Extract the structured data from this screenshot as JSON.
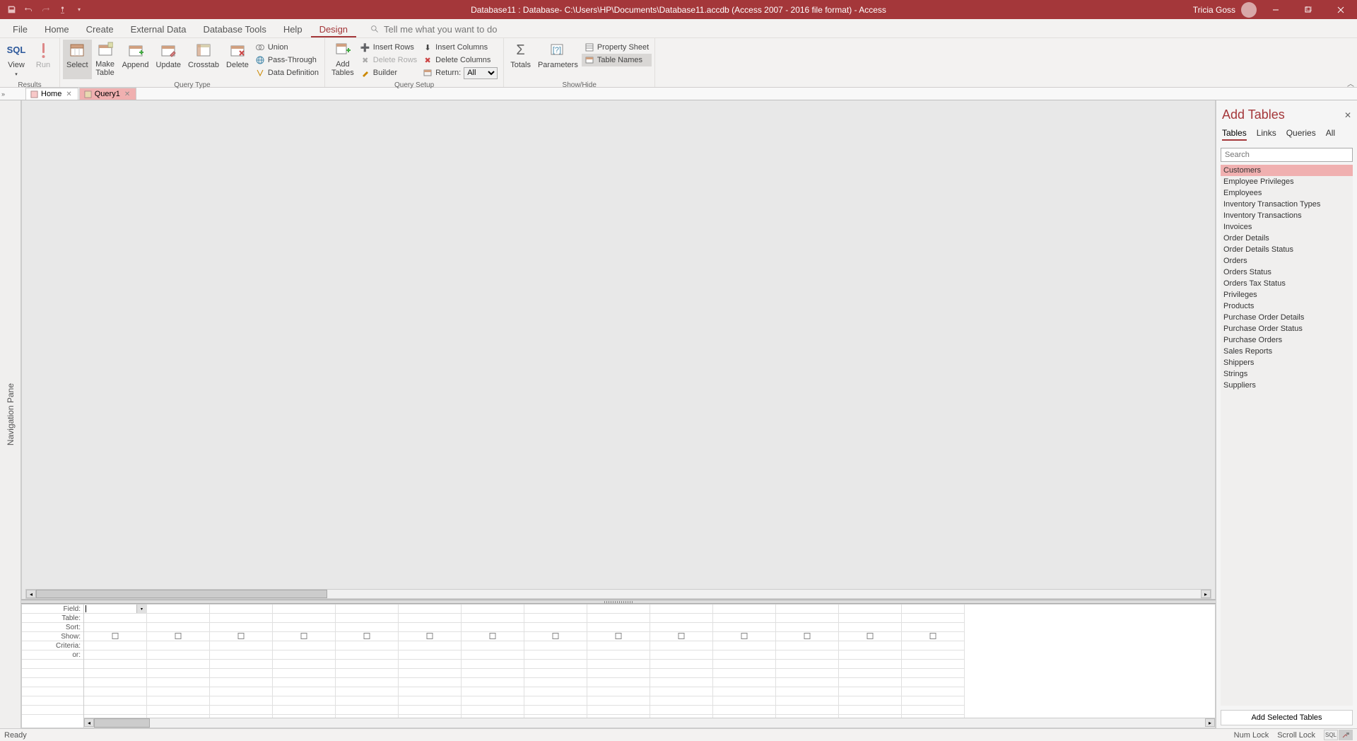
{
  "titlebar": {
    "title": "Database11 : Database- C:\\Users\\HP\\Documents\\Database11.accdb (Access 2007 - 2016 file format)  -  Access",
    "user": "Tricia Goss"
  },
  "menu": {
    "tabs": [
      "File",
      "Home",
      "Create",
      "External Data",
      "Database Tools",
      "Help",
      "Design"
    ],
    "active": "Design",
    "tellme": "Tell me what you want to do"
  },
  "ribbon": {
    "results": {
      "label": "Results",
      "view": "View",
      "sql": "SQL",
      "run": "Run"
    },
    "queryType": {
      "label": "Query Type",
      "select": "Select",
      "makeTable": "Make\nTable",
      "append": "Append",
      "update": "Update",
      "crosstab": "Crosstab",
      "delete": "Delete",
      "union": "Union",
      "passThrough": "Pass-Through",
      "dataDef": "Data Definition"
    },
    "querySetup": {
      "label": "Query Setup",
      "addTables": "Add\nTables",
      "insertRows": "Insert Rows",
      "deleteRows": "Delete Rows",
      "builder": "Builder",
      "insertCols": "Insert Columns",
      "deleteCols": "Delete Columns",
      "return": "Return:",
      "returnVal": "All"
    },
    "showHide": {
      "label": "Show/Hide",
      "totals": "Totals",
      "parameters": "Parameters",
      "propertySheet": "Property Sheet",
      "tableNames": "Table Names"
    }
  },
  "objTabs": [
    {
      "label": "Home",
      "active": false
    },
    {
      "label": "Query1",
      "active": true
    }
  ],
  "navPane": {
    "label": "Navigation Pane"
  },
  "grid": {
    "rows": [
      "Field:",
      "Table:",
      "Sort:",
      "Show:",
      "Criteria:",
      "or:"
    ]
  },
  "addTables": {
    "title": "Add Tables",
    "tabs": [
      "Tables",
      "Links",
      "Queries",
      "All"
    ],
    "activeTab": "Tables",
    "searchPlaceholder": "Search",
    "items": [
      "Customers",
      "Employee Privileges",
      "Employees",
      "Inventory Transaction Types",
      "Inventory Transactions",
      "Invoices",
      "Order Details",
      "Order Details Status",
      "Orders",
      "Orders Status",
      "Orders Tax Status",
      "Privileges",
      "Products",
      "Purchase Order Details",
      "Purchase Order Status",
      "Purchase Orders",
      "Sales Reports",
      "Shippers",
      "Strings",
      "Suppliers"
    ],
    "selected": "Customers",
    "addBtn": "Add Selected Tables"
  },
  "status": {
    "ready": "Ready",
    "numLock": "Num Lock",
    "scrollLock": "Scroll Lock",
    "sql": "SQL"
  }
}
